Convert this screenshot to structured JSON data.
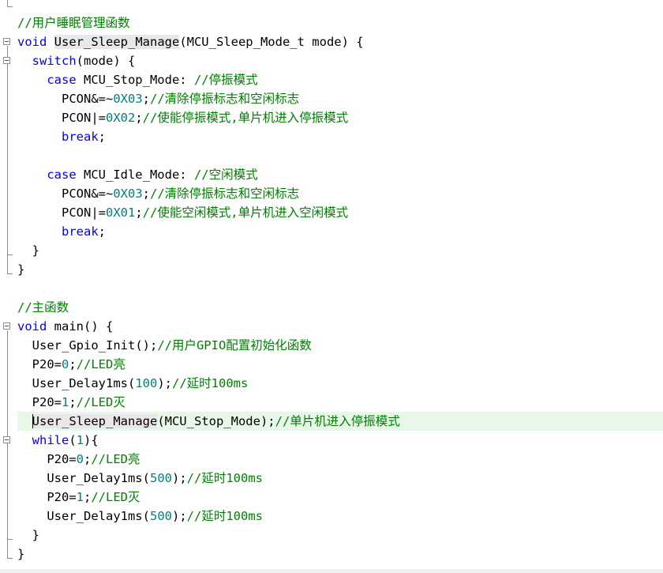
{
  "editor": {
    "lines": [
      {
        "indent": "",
        "parts": [
          {
            "t": "",
            "c": ""
          }
        ]
      },
      {
        "indent": "",
        "parts": [
          {
            "t": "//用户睡眠管理函数",
            "c": "cm"
          }
        ]
      },
      {
        "indent": "",
        "parts": [
          {
            "t": "void",
            "c": "kw"
          },
          {
            "t": " ",
            "c": ""
          },
          {
            "t": "User_Sleep_Manage",
            "c": "hl"
          },
          {
            "t": "(MCU_Sleep_Mode_t mode) {",
            "c": ""
          }
        ]
      },
      {
        "indent": "  ",
        "parts": [
          {
            "t": "switch",
            "c": "kw"
          },
          {
            "t": "(mode) {",
            "c": ""
          }
        ]
      },
      {
        "indent": "    ",
        "parts": [
          {
            "t": "case",
            "c": "kw"
          },
          {
            "t": " MCU_Stop_Mode: ",
            "c": ""
          },
          {
            "t": "//停振模式",
            "c": "cm"
          }
        ]
      },
      {
        "indent": "      ",
        "parts": [
          {
            "t": "PCON&=~",
            "c": ""
          },
          {
            "t": "0X03",
            "c": "num"
          },
          {
            "t": ";",
            "c": ""
          },
          {
            "t": "//清除停振标志和空闲标志",
            "c": "cm"
          }
        ]
      },
      {
        "indent": "      ",
        "parts": [
          {
            "t": "PCON|=",
            "c": ""
          },
          {
            "t": "0X02",
            "c": "num"
          },
          {
            "t": ";",
            "c": ""
          },
          {
            "t": "//使能停振模式,单片机进入停振模式",
            "c": "cm"
          }
        ]
      },
      {
        "indent": "      ",
        "parts": [
          {
            "t": "break",
            "c": "kw"
          },
          {
            "t": ";",
            "c": ""
          }
        ]
      },
      {
        "indent": "",
        "parts": [
          {
            "t": "",
            "c": ""
          }
        ]
      },
      {
        "indent": "    ",
        "parts": [
          {
            "t": "case",
            "c": "kw"
          },
          {
            "t": " MCU_Idle_Mode: ",
            "c": ""
          },
          {
            "t": "//空闲模式",
            "c": "cm"
          }
        ]
      },
      {
        "indent": "      ",
        "parts": [
          {
            "t": "PCON&=~",
            "c": ""
          },
          {
            "t": "0X03",
            "c": "num"
          },
          {
            "t": ";",
            "c": ""
          },
          {
            "t": "//清除停振标志和空闲标志",
            "c": "cm"
          }
        ]
      },
      {
        "indent": "      ",
        "parts": [
          {
            "t": "PCON|=",
            "c": ""
          },
          {
            "t": "0X01",
            "c": "num"
          },
          {
            "t": ";",
            "c": ""
          },
          {
            "t": "//使能空闲模式,单片机进入空闲模式",
            "c": "cm"
          }
        ]
      },
      {
        "indent": "      ",
        "parts": [
          {
            "t": "break",
            "c": "kw"
          },
          {
            "t": ";",
            "c": ""
          }
        ]
      },
      {
        "indent": "  ",
        "parts": [
          {
            "t": "}",
            "c": ""
          }
        ]
      },
      {
        "indent": "",
        "parts": [
          {
            "t": "}",
            "c": ""
          }
        ]
      },
      {
        "indent": "",
        "parts": [
          {
            "t": "",
            "c": ""
          }
        ]
      },
      {
        "indent": "",
        "parts": [
          {
            "t": "//主函数",
            "c": "cm"
          }
        ]
      },
      {
        "indent": "",
        "parts": [
          {
            "t": "void",
            "c": "kw"
          },
          {
            "t": " main() {",
            "c": ""
          }
        ]
      },
      {
        "indent": "  ",
        "parts": [
          {
            "t": "User_Gpio_Init();",
            "c": ""
          },
          {
            "t": "//用户GPIO配置初始化函数",
            "c": "cm"
          }
        ]
      },
      {
        "indent": "  ",
        "parts": [
          {
            "t": "P20=",
            "c": ""
          },
          {
            "t": "0",
            "c": "num"
          },
          {
            "t": ";",
            "c": ""
          },
          {
            "t": "//LED亮",
            "c": "cm"
          }
        ]
      },
      {
        "indent": "  ",
        "parts": [
          {
            "t": "User_Delay1ms(",
            "c": ""
          },
          {
            "t": "100",
            "c": "num"
          },
          {
            "t": ");",
            "c": ""
          },
          {
            "t": "//延时100ms",
            "c": "cm"
          }
        ]
      },
      {
        "indent": "  ",
        "parts": [
          {
            "t": "P20=",
            "c": ""
          },
          {
            "t": "1",
            "c": "num"
          },
          {
            "t": ";",
            "c": ""
          },
          {
            "t": "//LED灭",
            "c": "cm"
          }
        ]
      },
      {
        "indent": "  ",
        "parts": [
          {
            "t": "User_Sleep_Manage",
            "c": "hl"
          },
          {
            "t": "(MCU_Stop_Mode);",
            "c": ""
          },
          {
            "t": "//单片机进入停振模式",
            "c": "cm"
          }
        ],
        "current": true
      },
      {
        "indent": "  ",
        "parts": [
          {
            "t": "while",
            "c": "kw"
          },
          {
            "t": "(",
            "c": ""
          },
          {
            "t": "1",
            "c": "num"
          },
          {
            "t": "){",
            "c": ""
          }
        ]
      },
      {
        "indent": "    ",
        "parts": [
          {
            "t": "P20=",
            "c": ""
          },
          {
            "t": "0",
            "c": "num"
          },
          {
            "t": ";",
            "c": ""
          },
          {
            "t": "//LED亮",
            "c": "cm"
          }
        ]
      },
      {
        "indent": "    ",
        "parts": [
          {
            "t": "User_Delay1ms(",
            "c": ""
          },
          {
            "t": "500",
            "c": "num"
          },
          {
            "t": ");",
            "c": ""
          },
          {
            "t": "//延时100ms",
            "c": "cm"
          }
        ]
      },
      {
        "indent": "    ",
        "parts": [
          {
            "t": "P20=",
            "c": ""
          },
          {
            "t": "1",
            "c": "num"
          },
          {
            "t": ";",
            "c": ""
          },
          {
            "t": "//LED灭",
            "c": "cm"
          }
        ]
      },
      {
        "indent": "    ",
        "parts": [
          {
            "t": "User_Delay1ms(",
            "c": ""
          },
          {
            "t": "500",
            "c": "num"
          },
          {
            "t": ");",
            "c": ""
          },
          {
            "t": "//延时100ms",
            "c": "cm"
          }
        ]
      },
      {
        "indent": "  ",
        "parts": [
          {
            "t": "}",
            "c": ""
          }
        ]
      },
      {
        "indent": "",
        "parts": [
          {
            "t": "}",
            "c": ""
          }
        ]
      }
    ]
  }
}
